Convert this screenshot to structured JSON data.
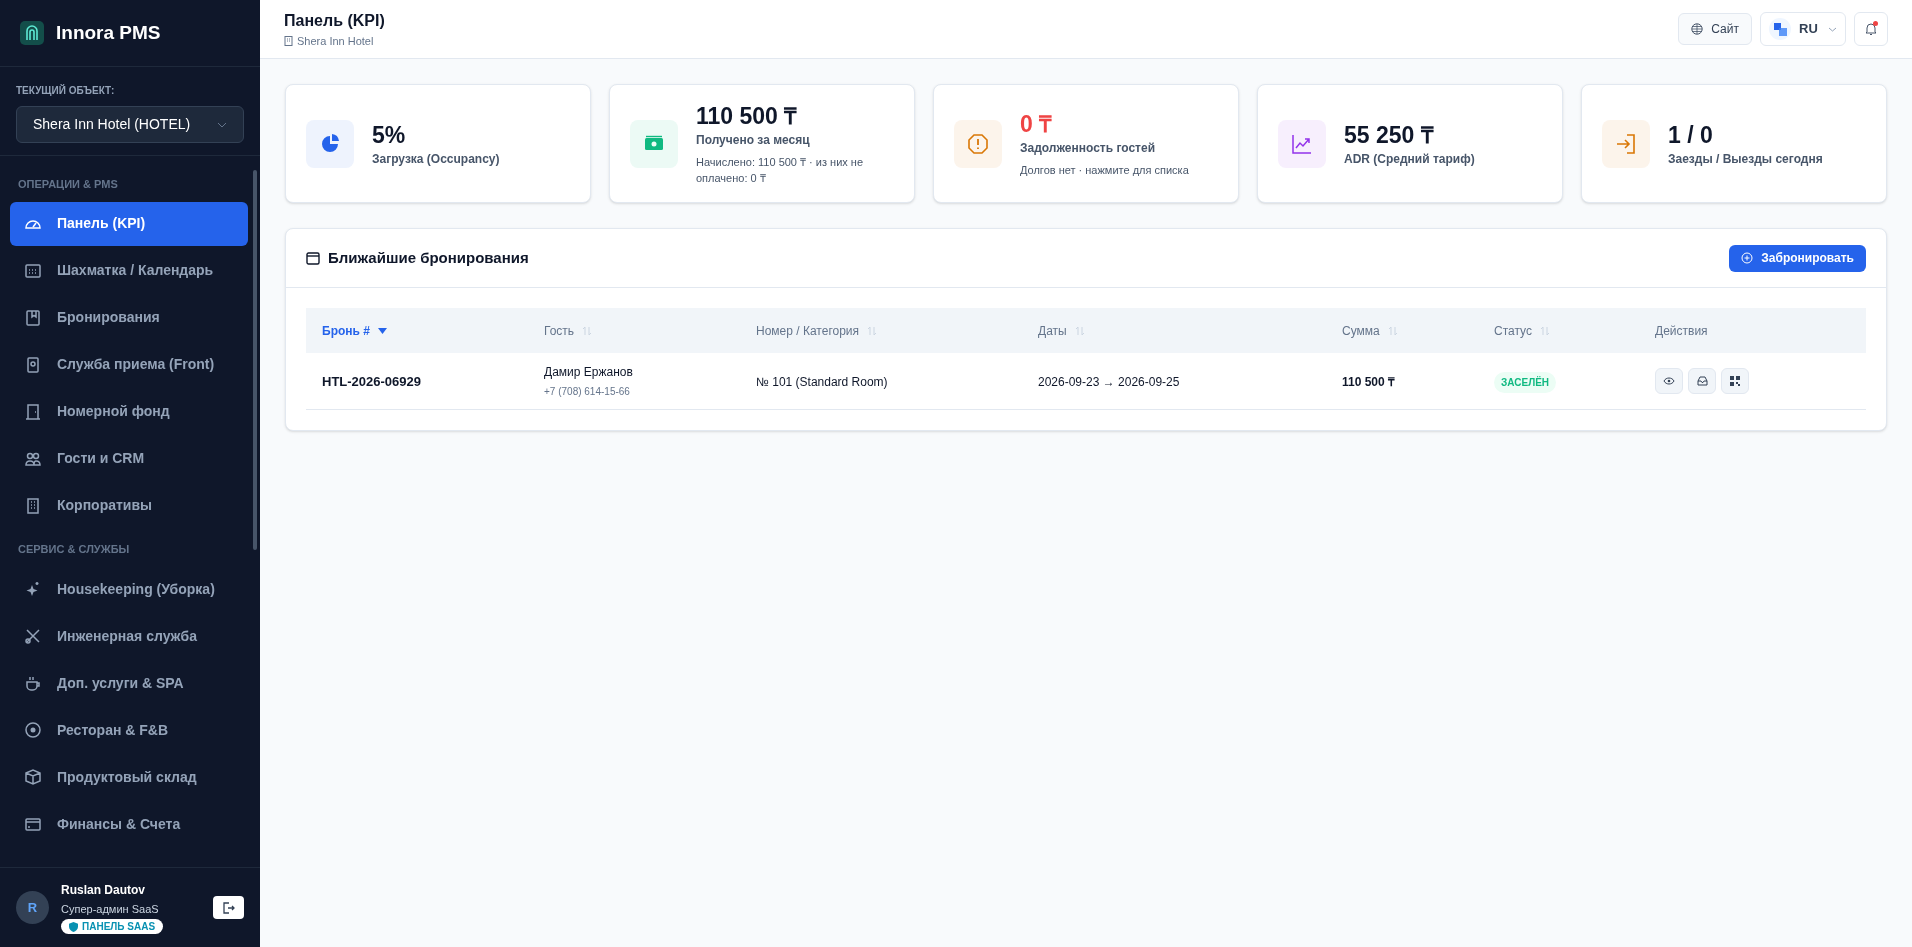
{
  "sidebar": {
    "brand": "Innora PMS",
    "property_label": "ТЕКУЩИЙ ОБЪЕКТ:",
    "property_value": "Shera Inn Hotel (HOTEL)",
    "sections": [
      {
        "title": "ОПЕРАЦИИ & PMS",
        "items": [
          {
            "label": "Панель (KPI)",
            "selected": true
          },
          {
            "label": "Шахматка / Календарь",
            "selected": false
          },
          {
            "label": "Бронирования",
            "selected": false
          },
          {
            "label": "Служба приема (Front)",
            "selected": false
          },
          {
            "label": "Номерной фонд",
            "selected": false
          },
          {
            "label": "Гости и CRM",
            "selected": false
          },
          {
            "label": "Корпоративы",
            "selected": false
          }
        ]
      },
      {
        "title": "СЕРВИС & СЛУЖБЫ",
        "items": [
          {
            "label": "Housekeeping (Уборка)",
            "selected": false
          },
          {
            "label": "Инженерная служба",
            "selected": false
          },
          {
            "label": "Доп. услуги & SPA",
            "selected": false
          },
          {
            "label": "Ресторан & F&B",
            "selected": false
          },
          {
            "label": "Продуктовый склад",
            "selected": false
          },
          {
            "label": "Финансы & Счета",
            "selected": false
          }
        ]
      }
    ],
    "user": {
      "initial": "R",
      "name": "Ruslan Dautov",
      "role": "Супер-админ SaaS",
      "badge": "ПАНЕЛЬ SAAS"
    }
  },
  "header": {
    "title": "Панель (KPI)",
    "subtitle": "Shera Inn Hotel",
    "site_button": "Сайт",
    "language": "RU",
    "has_notifications": true
  },
  "kpis": [
    {
      "value": "5%",
      "label": "Загрузка (Occupancy)",
      "color": "#2563eb",
      "alert": false
    },
    {
      "value": "110 500 ₸",
      "label": "Получено за месяц",
      "note": "Начислено: 110 500 ₸ · из них не оплачено: 0 ₸",
      "color": "#10b981",
      "alert": false
    },
    {
      "value": "0 ₸",
      "label": "Задолженность гостей",
      "note": "Долгов нет · нажмите для списка",
      "color": "#d97706",
      "alert": true
    },
    {
      "value": "55 250 ₸",
      "label": "ADR (Средний тариф)",
      "color": "#9333ea",
      "alert": false
    },
    {
      "value": "1 / 0",
      "label": "Заезды / Выезды сегодня",
      "color": "#d97706",
      "alert": false
    }
  ],
  "bookings": {
    "title": "Ближайшие бронирования",
    "button": "Забронировать",
    "columns": [
      {
        "label": "Бронь #",
        "sorted": true
      },
      {
        "label": "Гость",
        "sorted": false
      },
      {
        "label": "Номер / Категория",
        "sorted": false
      },
      {
        "label": "Даты",
        "sorted": false
      },
      {
        "label": "Сумма",
        "sorted": false
      },
      {
        "label": "Статус",
        "sorted": false
      },
      {
        "label": "Действия",
        "sorted": false
      }
    ],
    "rows": [
      {
        "id": "HTL-2026-06929",
        "guest": "Дамир Ержанов",
        "phone": "+7 (708) 614-15-66",
        "room": "№ 101 (Standard Room)",
        "dates": "2026-09-23 → 2026-09-25",
        "amount": "110 500 ₸",
        "status": "ЗАСЕЛЁН"
      }
    ]
  }
}
